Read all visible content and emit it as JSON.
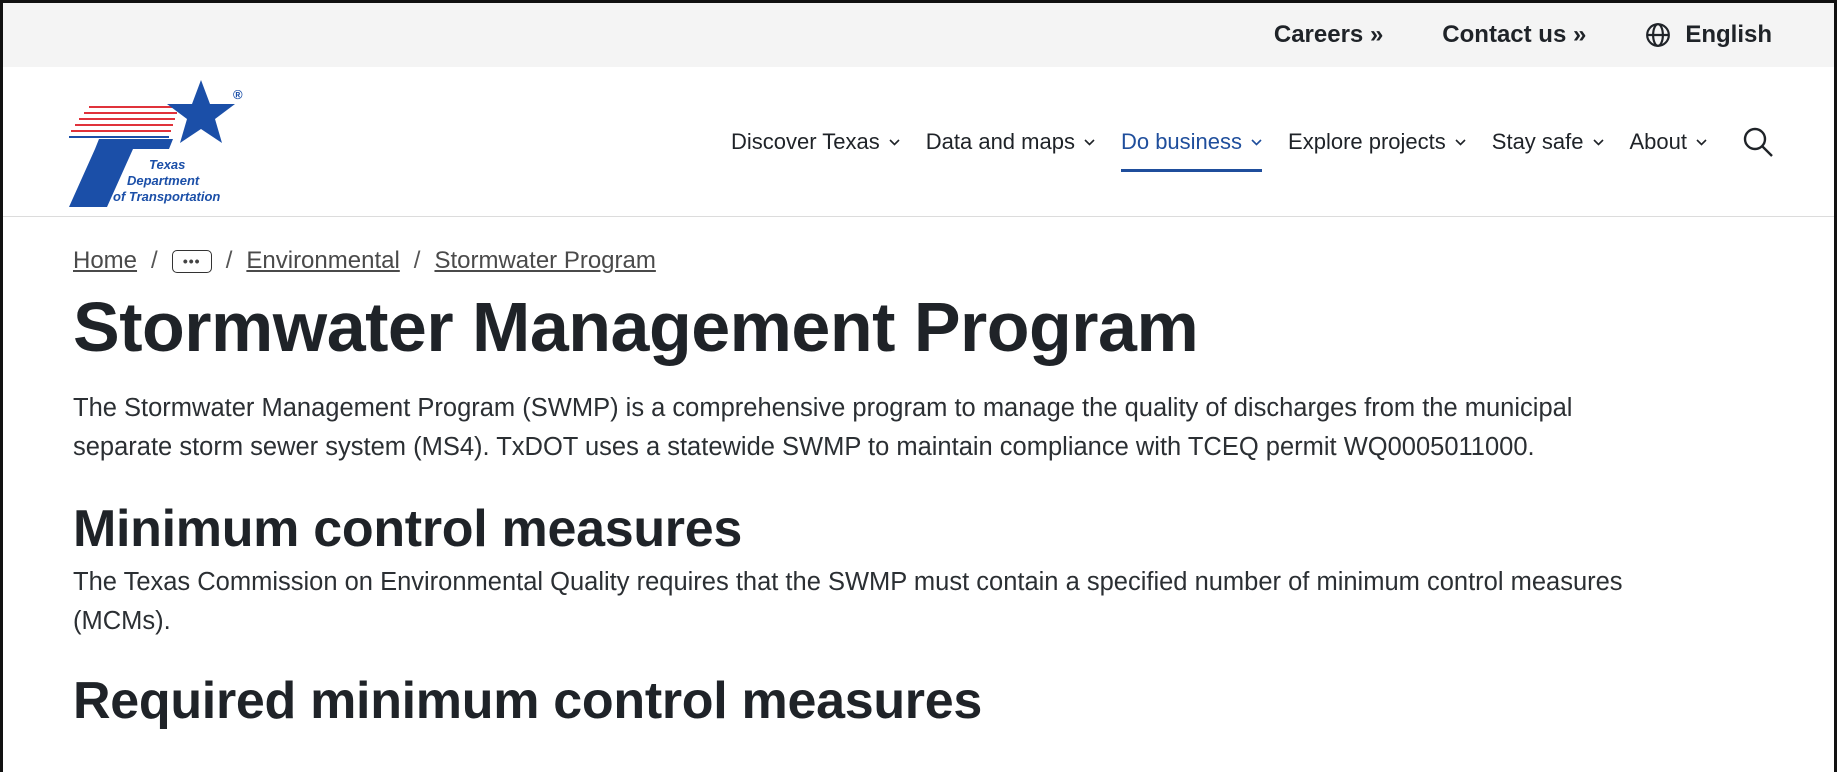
{
  "utility": {
    "careers": "Careers »",
    "contact": "Contact us »",
    "language": "English",
    "language_icon": "globe-icon"
  },
  "logo": {
    "line1": "Texas",
    "line2": "Department",
    "line3": "of Transportation",
    "registered": "®",
    "colors": {
      "blue": "#1b4fa8",
      "red": "#e0323b"
    }
  },
  "nav": {
    "items": [
      {
        "label": "Discover Texas",
        "active": false
      },
      {
        "label": "Data and maps",
        "active": false
      },
      {
        "label": "Do business",
        "active": true
      },
      {
        "label": "Explore projects",
        "active": false
      },
      {
        "label": "Stay safe",
        "active": false
      },
      {
        "label": "About",
        "active": false
      }
    ],
    "search_icon": "search-icon",
    "accent_color": "#1f4e9c"
  },
  "breadcrumb": {
    "home": "Home",
    "separator": "/",
    "more": "•••",
    "environmental": "Environmental",
    "current": "Stormwater Program"
  },
  "main": {
    "title": "Stormwater Management Program",
    "intro_line1": "The Stormwater Management Program (SWMP) is a comprehensive program to manage the quality of discharges from the municipal",
    "intro_line2": "separate storm sewer system (MS4). TxDOT uses a statewide SWMP to maintain compliance with TCEQ permit WQ0005011000.",
    "section1_heading": "Minimum control measures",
    "section1_line1": "The Texas Commission on Environmental Quality requires that the SWMP must contain a specified number of minimum control measures",
    "section1_line2": "(MCMs).",
    "section2_heading": "Required minimum control measures"
  }
}
